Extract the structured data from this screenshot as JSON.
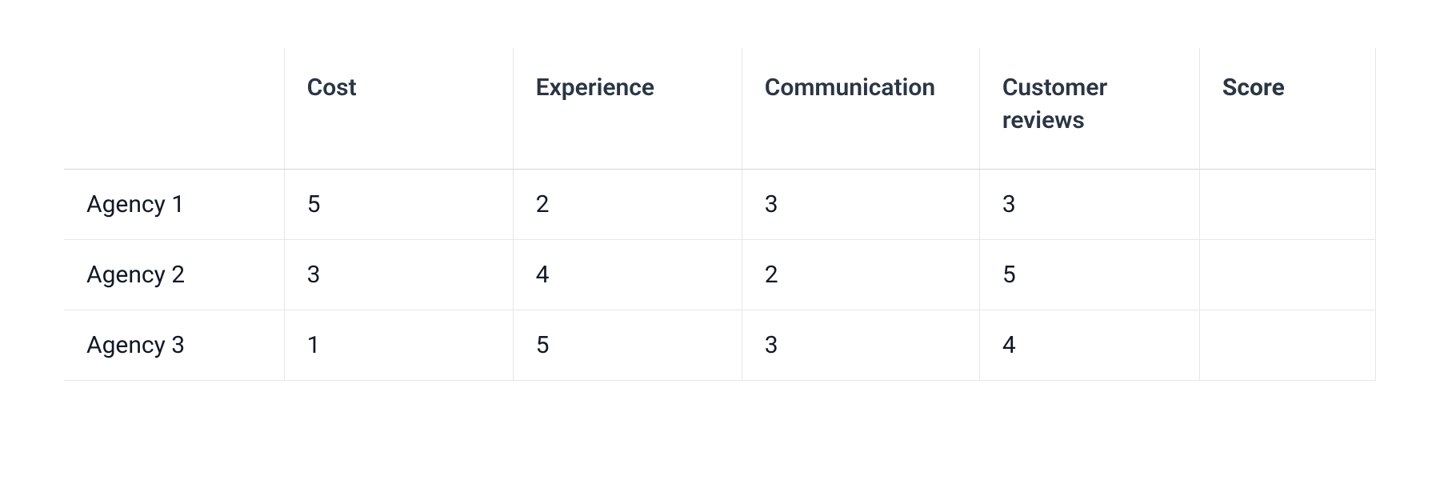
{
  "chart_data": {
    "type": "table",
    "columns": [
      "",
      "Cost",
      "Experience",
      "Communication",
      "Customer reviews",
      "Score"
    ],
    "rows": [
      {
        "label": "Agency 1",
        "values": [
          "5",
          "2",
          "3",
          "3",
          ""
        ]
      },
      {
        "label": "Agency 2",
        "values": [
          "3",
          "4",
          "2",
          "5",
          ""
        ]
      },
      {
        "label": "Agency 3",
        "values": [
          "1",
          "5",
          "3",
          "4",
          ""
        ]
      }
    ]
  },
  "table": {
    "headers": {
      "blank": "",
      "cost": "Cost",
      "experience": "Experience",
      "communication": "Communication",
      "reviews": "Customer reviews",
      "score": "Score"
    },
    "rows": [
      {
        "label": "Agency 1",
        "cost": "5",
        "experience": "2",
        "communication": "3",
        "reviews": "3",
        "score": ""
      },
      {
        "label": "Agency 2",
        "cost": "3",
        "experience": "4",
        "communication": "2",
        "reviews": "5",
        "score": ""
      },
      {
        "label": "Agency 3",
        "cost": "1",
        "experience": "5",
        "communication": "3",
        "reviews": "4",
        "score": ""
      }
    ]
  }
}
